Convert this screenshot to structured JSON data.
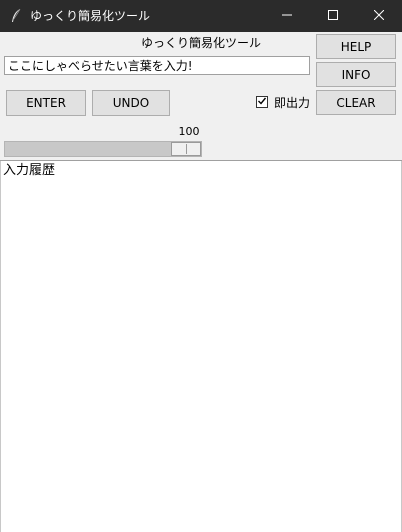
{
  "window": {
    "title": "ゆっくり簡易化ツール",
    "app_icon": "feather-icon",
    "minimize_icon": "minimize-icon",
    "maximize_icon": "maximize-icon",
    "close_icon": "close-icon"
  },
  "header": {
    "label": "ゆっくり簡易化ツール"
  },
  "input": {
    "value": "ここにしゃべらせたい言葉を入力!"
  },
  "buttons": {
    "help": "HELP",
    "info": "INFO",
    "clear": "CLEAR",
    "enter": "ENTER",
    "undo": "UNDO"
  },
  "instant_output": {
    "label": "即出力",
    "checked": true
  },
  "scale": {
    "value": "100",
    "fraction": 1.0
  },
  "history": {
    "title": "入力履歴"
  },
  "colors": {
    "titlebar_bg": "#2b2b2b",
    "panel_bg": "#f0f0f0",
    "button_bg": "#e1e1e1"
  }
}
